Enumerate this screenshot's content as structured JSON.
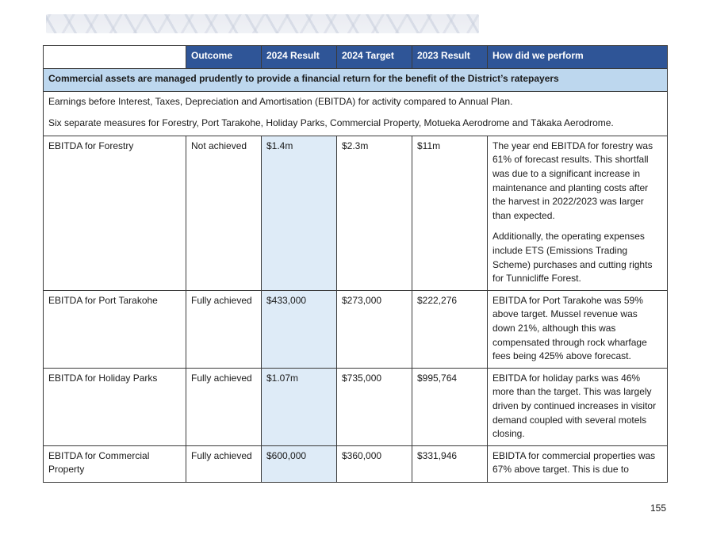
{
  "table": {
    "headers": {
      "blank": "",
      "outcome": "Outcome",
      "result_2024": "2024 Result",
      "target_2024": "2024 Target",
      "result_2023": "2023 Result",
      "performance": "How did we perform"
    },
    "goal": "Commercial assets are managed prudently to provide a financial return for the benefit of the District’s ratepayers",
    "description": [
      "Earnings before Interest, Taxes, Depreciation and Amortisation (EBITDA) for activity compared to Annual Plan.",
      "Six separate measures for Forestry, Port Tarakohe, Holiday Parks, Commercial Property, Motueka Aerodrome and Tākaka Aerodrome."
    ],
    "rows": [
      {
        "measure": "EBITDA for Forestry",
        "outcome": "Not achieved",
        "result_2024": "$1.4m",
        "target_2024": "$2.3m",
        "result_2023": "$11m",
        "performance": [
          "The year end EBITDA for forestry was 61% of forecast results. This shortfall was due to a significant increase in maintenance and planting costs after the harvest in 2022/2023 was larger than expected.",
          "Additionally, the operating expenses include ETS (Emissions Trading Scheme) purchases and cutting rights for Tunnicliffe Forest."
        ]
      },
      {
        "measure": "EBITDA for Port Tarakohe",
        "outcome": "Fully achieved",
        "result_2024": "$433,000",
        "target_2024": "$273,000",
        "result_2023": "$222,276",
        "performance": [
          "EBITDA for Port Tarakohe was 59% above target.  Mussel revenue was down 21%, although this was compensated through rock wharfage fees being 425% above forecast."
        ]
      },
      {
        "measure": "EBITDA for Holiday Parks",
        "outcome": "Fully achieved",
        "result_2024": "$1.07m",
        "target_2024": "$735,000",
        "result_2023": "$995,764",
        "performance": [
          "EBITDA for holiday parks was 46% more than the target. This was largely driven by continued increases in visitor demand coupled with several motels closing."
        ]
      },
      {
        "measure": "EBITDA for Commercial Property",
        "outcome": "Fully achieved",
        "result_2024": "$600,000",
        "target_2024": "$360,000",
        "result_2023": "$331,946",
        "performance": [
          "EBIDTA for commercial properties was 67% above target. This is due to"
        ]
      }
    ]
  },
  "page_number": "155"
}
